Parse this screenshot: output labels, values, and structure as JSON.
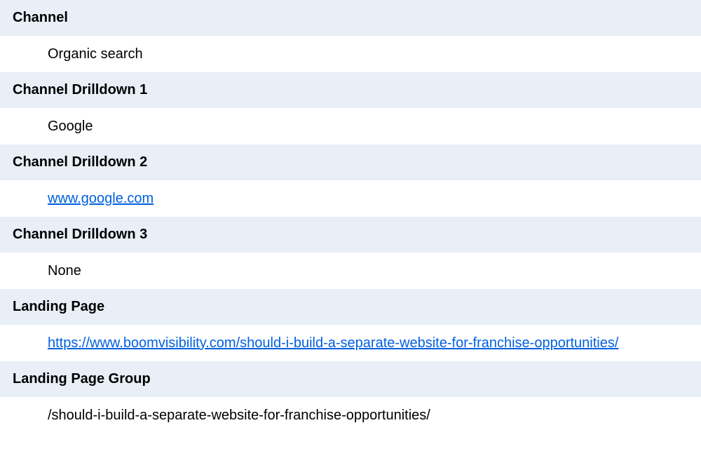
{
  "rows": [
    {
      "header": "Channel",
      "value": "Organic search",
      "isLink": false
    },
    {
      "header": "Channel Drilldown 1",
      "value": "Google",
      "isLink": false
    },
    {
      "header": "Channel Drilldown 2",
      "value": "www.google.com",
      "isLink": true
    },
    {
      "header": "Channel Drilldown 3",
      "value": "None",
      "isLink": false
    },
    {
      "header": "Landing Page",
      "value": "https://www.boomvisibility.com/should-i-build-a-separate-website-for-franchise-opportunities/",
      "isLink": true
    },
    {
      "header": "Landing Page Group",
      "value": "/should-i-build-a-separate-website-for-franchise-opportunities/",
      "isLink": false
    }
  ]
}
